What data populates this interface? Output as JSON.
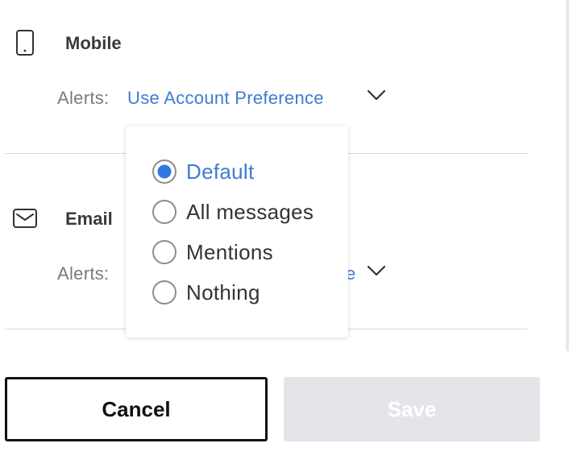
{
  "channels": {
    "mobile": {
      "label": "Mobile",
      "icon": "mobile-phone-icon",
      "alerts_label": "Alerts:",
      "alerts_value": "Use Account Preference"
    },
    "email": {
      "label": "Email",
      "icon": "envelope-icon",
      "alerts_label": "Alerts:",
      "alerts_value_visible_fragment": "e"
    }
  },
  "dropdown": {
    "options": [
      {
        "label": "Default",
        "selected": true
      },
      {
        "label": "All messages",
        "selected": false
      },
      {
        "label": "Mentions",
        "selected": false
      },
      {
        "label": "Nothing",
        "selected": false
      }
    ]
  },
  "actions": {
    "cancel_label": "Cancel",
    "save_label": "Save",
    "save_enabled": false
  },
  "colors": {
    "accent": "#3f7bd4",
    "radio_selected": "#2f78e6",
    "save_disabled_bg": "#e3e5e8"
  }
}
